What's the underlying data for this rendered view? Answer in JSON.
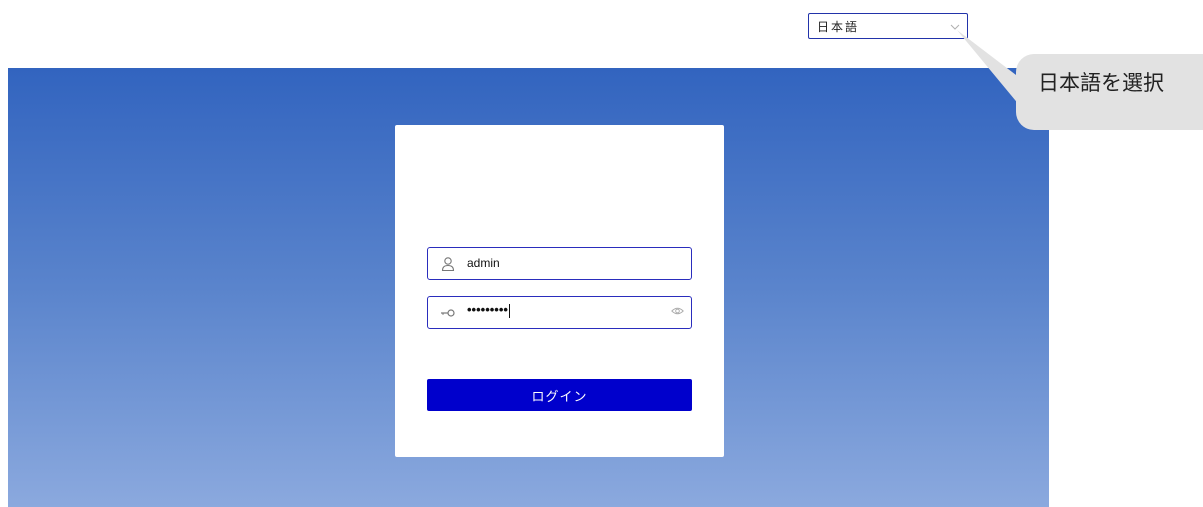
{
  "language_select": {
    "selected": "日本語"
  },
  "login": {
    "username_value": "admin",
    "password_mask": "•••••••••",
    "submit_label": "ログイン"
  },
  "callout": {
    "text": "日本語を選択"
  },
  "colors": {
    "primary": "#0000cc",
    "field_border": "#2a2dbd",
    "hero_top": "#3264bf",
    "hero_bottom": "#8ba9de",
    "callout_bg": "#e2e2e2"
  },
  "icons": {
    "username": "user-icon",
    "password": "key-icon",
    "toggle_password": "eye-icon",
    "language_dropdown": "chevron-down-icon"
  }
}
